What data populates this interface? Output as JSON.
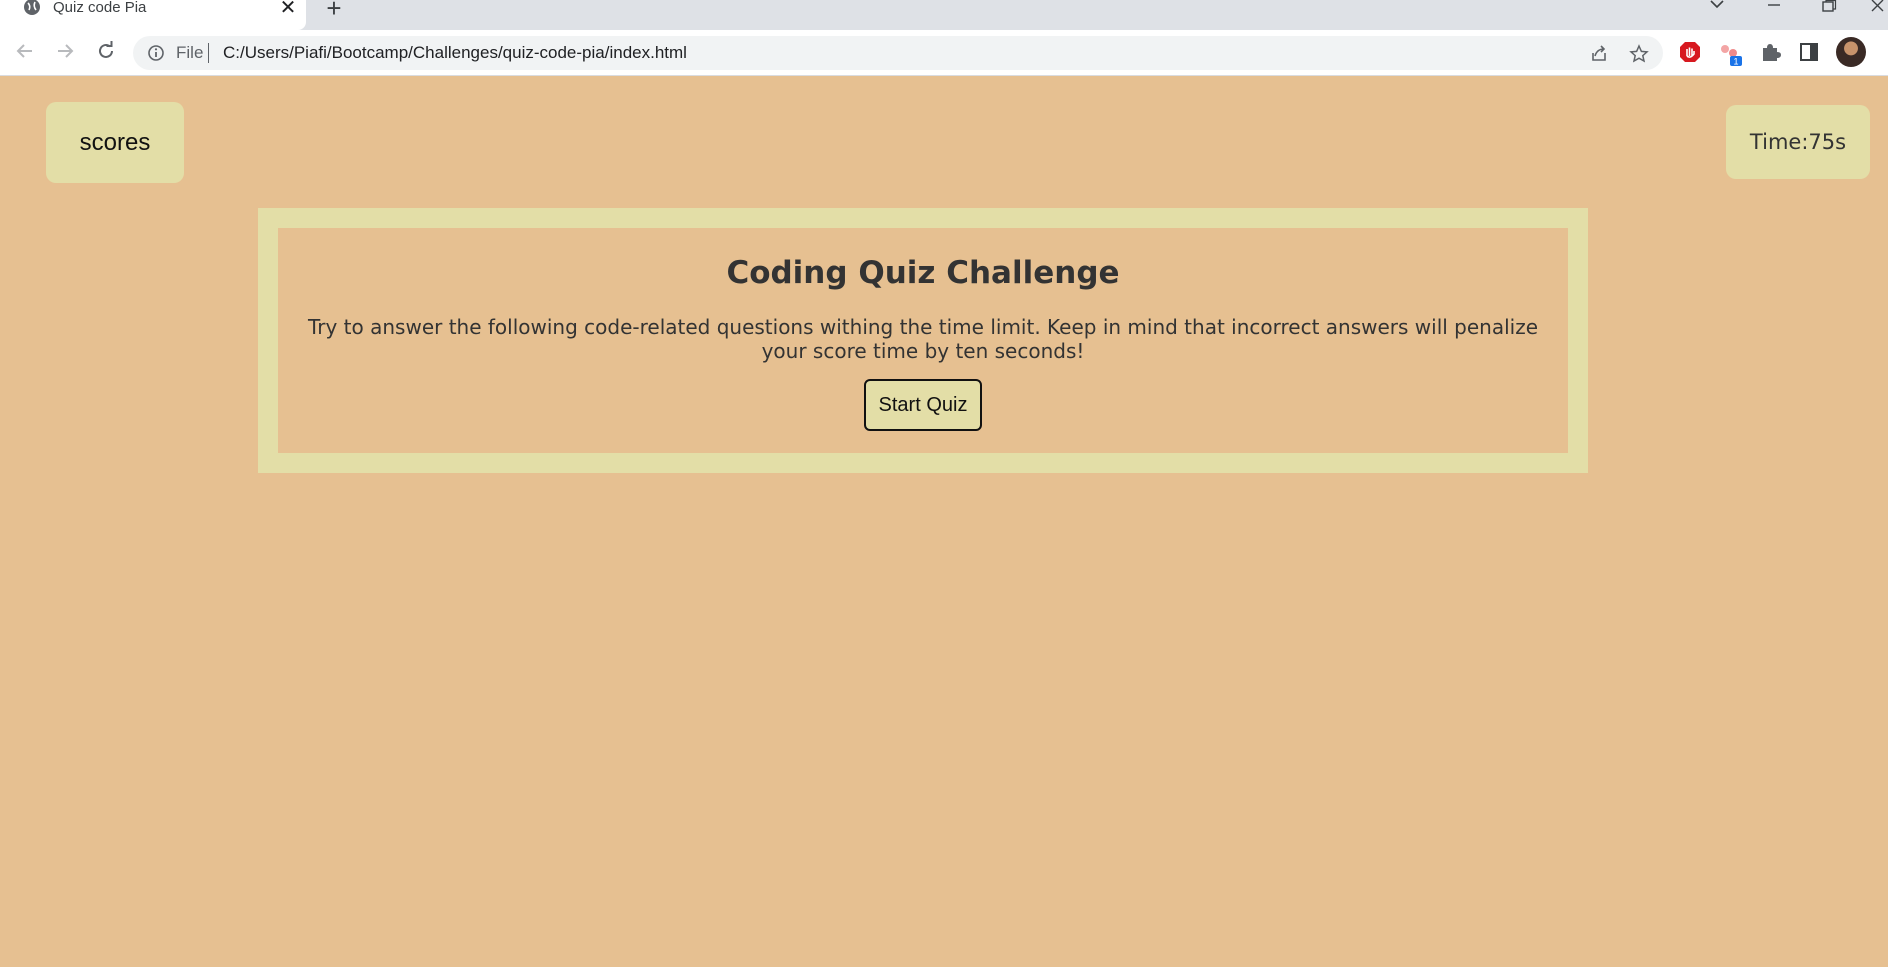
{
  "browser": {
    "tab_title": "Quiz code Pia",
    "tab_close": "✕",
    "new_tab": "+",
    "address_scheme": "File",
    "address_url": "C:/Users/Piafi/Bootcamp/Challenges/quiz-code-pia/index.html",
    "extension_badge": "1"
  },
  "header": {
    "scores_label": "scores",
    "timer_text": "Time:75s"
  },
  "quiz": {
    "title": "Coding Quiz Challenge",
    "description": "Try to answer the following code-related questions withing the time limit. Keep in mind that incorrect answers will penalize your score time by ten seconds!",
    "start_label": "Start Quiz"
  },
  "colors": {
    "page_background": "#e6c091",
    "panel_background": "#e3dea7"
  }
}
